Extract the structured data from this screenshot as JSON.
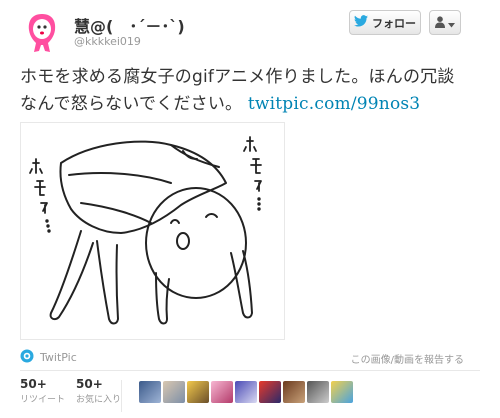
{
  "user": {
    "name": "慧@(　･´－･`)",
    "handle": "@kkkkei019"
  },
  "buttons": {
    "follow_label": "フォロー"
  },
  "tweet": {
    "text": "ホモを求める腐女子のgifアニメ作りました。ほんの冗談なんで怒らないでください。",
    "link": "twitpic.com/99nos3"
  },
  "media": {
    "alt": "ホモォ… illustration",
    "source": "TwitPic",
    "report": "この画像/動画を報告する"
  },
  "stats": {
    "retweets": {
      "count": "50+",
      "label": "リツイート"
    },
    "favorites": {
      "count": "50+",
      "label": "お気に入り"
    }
  },
  "colors": {
    "link": "#0084b4",
    "twitter_blue": "#2aa9e0",
    "avatar_pink": "#ff4fa0"
  },
  "icons": [
    "twitter-bird-icon",
    "user-icon",
    "caret-down-icon",
    "twitpic-icon"
  ]
}
